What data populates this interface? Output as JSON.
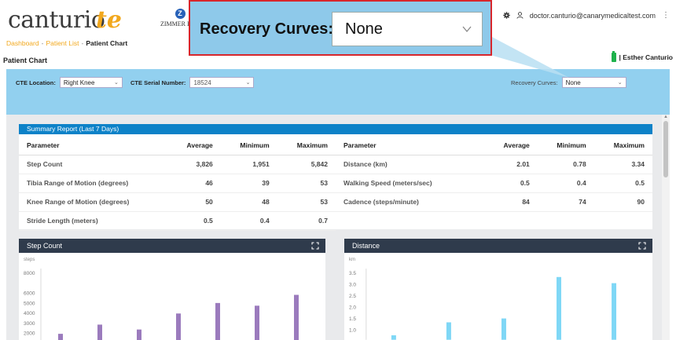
{
  "app": {
    "logo_text": "canturio",
    "logo_suffix": "te",
    "partner_logo_text": "ZIMMER BIOMET",
    "partner_logo_letter": "Z"
  },
  "breadcrumb": {
    "items": [
      "Dashboard",
      "Patient List"
    ],
    "current": "Patient Chart",
    "separator": "-"
  },
  "page_title": "Patient Chart",
  "header": {
    "user_email": "doctor.canturio@canarymedicaltest.com",
    "patient_name": "| Esther Canturio"
  },
  "callout": {
    "label": "Recovery Curves:",
    "value": "None"
  },
  "filters": {
    "cte_location_label": "CTE Location:",
    "cte_location_value": "Right Knee",
    "cte_serial_label": "CTE Serial Number:",
    "cte_serial_value": "18524",
    "recovery_label": "Recovery Curves:",
    "recovery_value": "None"
  },
  "summary": {
    "title": "Summary Report (Last 7 Days)",
    "columns": [
      "Parameter",
      "Average",
      "Minimum",
      "Maximum"
    ],
    "left_rows": [
      [
        "Step Count",
        "3,826",
        "1,951",
        "5,842"
      ],
      [
        "Tibia Range of Motion (degrees)",
        "46",
        "39",
        "53"
      ],
      [
        "Knee Range of Motion (degrees)",
        "50",
        "48",
        "53"
      ],
      [
        "Stride Length (meters)",
        "0.5",
        "0.4",
        "0.7"
      ]
    ],
    "right_rows": [
      [
        "Distance (km)",
        "2.01",
        "0.78",
        "3.34"
      ],
      [
        "Walking Speed (meters/sec)",
        "0.5",
        "0.4",
        "0.5"
      ],
      [
        "Cadence (steps/minute)",
        "84",
        "74",
        "90"
      ]
    ]
  },
  "chart_data": [
    {
      "type": "bar",
      "title": "Step Count",
      "ylabel": "steps",
      "ylim": [
        0,
        8000
      ],
      "yticks": [
        "8000",
        "6000",
        "5000",
        "4000",
        "3000",
        "2000"
      ],
      "ytick_values": [
        8000,
        6000,
        5000,
        4000,
        3000,
        2000
      ],
      "values": [
        1951,
        2870,
        2380,
        3980,
        5030,
        4760,
        5842
      ],
      "color": "#9b7bbd",
      "grid": false
    },
    {
      "type": "bar",
      "title": "Distance",
      "ylabel": "km",
      "ylim": [
        0,
        3.5
      ],
      "yticks": [
        "3.5",
        "3.0",
        "2.5",
        "2.0",
        "1.5",
        "1.0"
      ],
      "ytick_values": [
        3.5,
        3.0,
        2.5,
        2.0,
        1.5,
        1.0
      ],
      "values": [
        0.78,
        1.35,
        1.52,
        3.34,
        3.07
      ],
      "color": "#7fd7f6",
      "grid": false
    }
  ]
}
